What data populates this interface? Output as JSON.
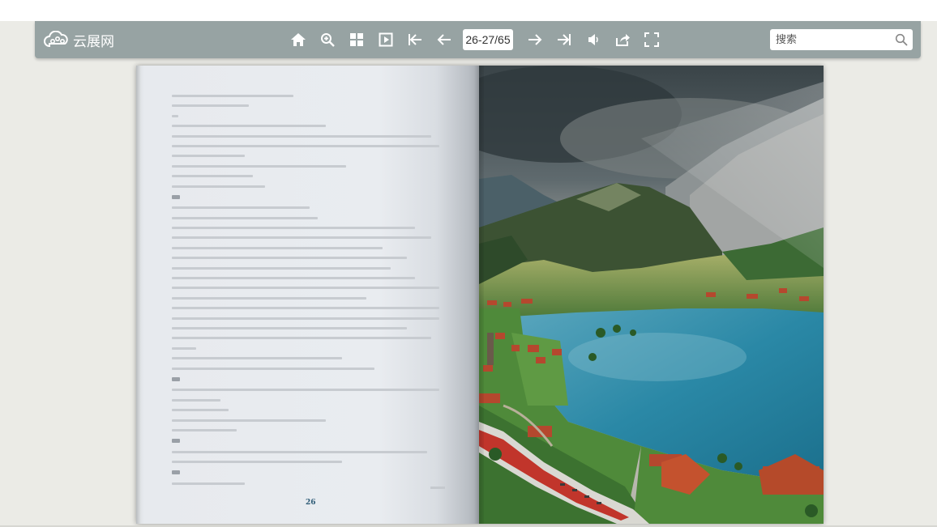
{
  "app": {
    "logo_text": "云展网"
  },
  "toolbar": {
    "icons": [
      "home-icon",
      "zoom-in-icon",
      "thumbnails-icon",
      "autoplay-icon",
      "first-page-icon",
      "previous-page-icon",
      "next-page-icon",
      "last-page-icon",
      "sound-icon",
      "share-icon",
      "fullscreen-icon"
    ],
    "page_indicator": "26-27/65"
  },
  "search": {
    "placeholder": "搜索"
  },
  "book": {
    "left_page": {
      "page_number": "26",
      "headings": [
        "五",
        "六",
        "七",
        "八"
      ]
    },
    "right_page": {
      "image": "alpine-lake-village-train-photo"
    }
  },
  "colors": {
    "toolbar": "#97a3a3",
    "background": "#ebebe6",
    "page_number": "#2c5a75"
  }
}
